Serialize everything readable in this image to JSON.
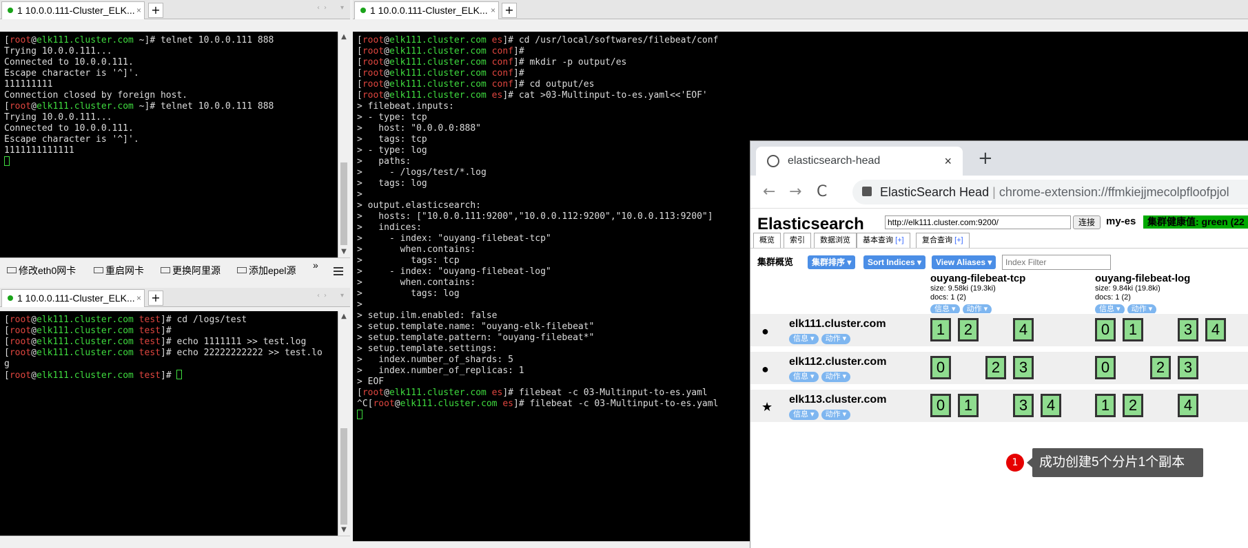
{
  "left_top": {
    "tab_label": "1 10.0.0.111-Cluster_ELK...",
    "close": "×",
    "add": "+",
    "lines": [
      [
        {
          "t": "[",
          "c": ""
        },
        {
          "t": "root",
          "c": "r"
        },
        {
          "t": "@",
          "c": ""
        },
        {
          "t": "elk111.cluster.com",
          "c": "g"
        },
        {
          "t": " ~]# telnet 10.0.0.111 888",
          "c": ""
        }
      ],
      [
        {
          "t": "Trying 10.0.0.111...",
          "c": ""
        }
      ],
      [
        {
          "t": "Connected to 10.0.0.111.",
          "c": ""
        }
      ],
      [
        {
          "t": "Escape character is '^]'.",
          "c": ""
        }
      ],
      [
        {
          "t": "111111111",
          "c": ""
        }
      ],
      [
        {
          "t": "Connection closed by foreign host.",
          "c": ""
        }
      ],
      [
        {
          "t": "[",
          "c": ""
        },
        {
          "t": "root",
          "c": "r"
        },
        {
          "t": "@",
          "c": ""
        },
        {
          "t": "elk111.cluster.com",
          "c": "g"
        },
        {
          "t": " ~]# telnet 10.0.0.111 888",
          "c": ""
        }
      ],
      [
        {
          "t": "Trying 10.0.0.111...",
          "c": ""
        }
      ],
      [
        {
          "t": "Connected to 10.0.0.111.",
          "c": ""
        }
      ],
      [
        {
          "t": "Escape character is '^]'.",
          "c": ""
        }
      ],
      [
        {
          "t": "1111111111111",
          "c": ""
        }
      ]
    ]
  },
  "left_toolbar": {
    "items": [
      "修改eth0网卡",
      "重启网卡",
      "更换阿里源",
      "添加epel源"
    ],
    "more": "»"
  },
  "left_bottom": {
    "tab_label": "1 10.0.0.111-Cluster_ELK...",
    "close": "×",
    "add": "+",
    "lines": [
      [
        {
          "t": "[",
          "c": ""
        },
        {
          "t": "root",
          "c": "r"
        },
        {
          "t": "@",
          "c": ""
        },
        {
          "t": "elk111.cluster.com",
          "c": "g"
        },
        {
          "t": " test",
          "c": "r"
        },
        {
          "t": "]# cd /logs/test",
          "c": ""
        }
      ],
      [
        {
          "t": "[",
          "c": ""
        },
        {
          "t": "root",
          "c": "r"
        },
        {
          "t": "@",
          "c": ""
        },
        {
          "t": "elk111.cluster.com",
          "c": "g"
        },
        {
          "t": " test",
          "c": "r"
        },
        {
          "t": "]#",
          "c": ""
        }
      ],
      [
        {
          "t": "[",
          "c": ""
        },
        {
          "t": "root",
          "c": "r"
        },
        {
          "t": "@",
          "c": ""
        },
        {
          "t": "elk111.cluster.com",
          "c": "g"
        },
        {
          "t": " test",
          "c": "r"
        },
        {
          "t": "]# echo 1111111 >> test.log",
          "c": ""
        }
      ],
      [
        {
          "t": "[",
          "c": ""
        },
        {
          "t": "root",
          "c": "r"
        },
        {
          "t": "@",
          "c": ""
        },
        {
          "t": "elk111.cluster.com",
          "c": "g"
        },
        {
          "t": " test",
          "c": "r"
        },
        {
          "t": "]# echo 22222222222 >> test.lo",
          "c": ""
        }
      ],
      [
        {
          "t": "g",
          "c": ""
        }
      ],
      [
        {
          "t": "[",
          "c": ""
        },
        {
          "t": "root",
          "c": "r"
        },
        {
          "t": "@",
          "c": ""
        },
        {
          "t": "elk111.cluster.com",
          "c": "g"
        },
        {
          "t": " test",
          "c": "r"
        },
        {
          "t": "]# ",
          "c": ""
        }
      ]
    ]
  },
  "right_term": {
    "tab_label": "1 10.0.0.111-Cluster_ELK...",
    "close": "×",
    "add": "+",
    "lines": [
      [
        {
          "t": "[",
          "c": ""
        },
        {
          "t": "root",
          "c": "r"
        },
        {
          "t": "@",
          "c": ""
        },
        {
          "t": "elk111.cluster.com",
          "c": "g"
        },
        {
          "t": " es",
          "c": "r"
        },
        {
          "t": "]# cd /usr/local/softwares/filebeat/conf",
          "c": ""
        }
      ],
      [
        {
          "t": "[",
          "c": ""
        },
        {
          "t": "root",
          "c": "r"
        },
        {
          "t": "@",
          "c": ""
        },
        {
          "t": "elk111.cluster.com",
          "c": "g"
        },
        {
          "t": " conf",
          "c": "r"
        },
        {
          "t": "]#",
          "c": ""
        }
      ],
      [
        {
          "t": "[",
          "c": ""
        },
        {
          "t": "root",
          "c": "r"
        },
        {
          "t": "@",
          "c": ""
        },
        {
          "t": "elk111.cluster.com",
          "c": "g"
        },
        {
          "t": " conf",
          "c": "r"
        },
        {
          "t": "]# mkdir -p output/es",
          "c": ""
        }
      ],
      [
        {
          "t": "[",
          "c": ""
        },
        {
          "t": "root",
          "c": "r"
        },
        {
          "t": "@",
          "c": ""
        },
        {
          "t": "elk111.cluster.com",
          "c": "g"
        },
        {
          "t": " conf",
          "c": "r"
        },
        {
          "t": "]#",
          "c": ""
        }
      ],
      [
        {
          "t": "[",
          "c": ""
        },
        {
          "t": "root",
          "c": "r"
        },
        {
          "t": "@",
          "c": ""
        },
        {
          "t": "elk111.cluster.com",
          "c": "g"
        },
        {
          "t": " conf",
          "c": "r"
        },
        {
          "t": "]# cd output/es",
          "c": ""
        }
      ],
      [
        {
          "t": "[",
          "c": ""
        },
        {
          "t": "root",
          "c": "r"
        },
        {
          "t": "@",
          "c": ""
        },
        {
          "t": "elk111.cluster.com",
          "c": "g"
        },
        {
          "t": " es",
          "c": "r"
        },
        {
          "t": "]# cat >03-Multinput-to-es.yaml<<'EOF'",
          "c": ""
        }
      ],
      [
        {
          "t": "> filebeat.inputs:",
          "c": ""
        }
      ],
      [
        {
          "t": "> - type: tcp",
          "c": ""
        }
      ],
      [
        {
          "t": ">   host: \"0.0.0.0:888\"",
          "c": ""
        }
      ],
      [
        {
          "t": ">   tags: tcp",
          "c": ""
        }
      ],
      [
        {
          "t": "> - type: log",
          "c": ""
        }
      ],
      [
        {
          "t": ">   paths:",
          "c": ""
        }
      ],
      [
        {
          "t": ">     - /logs/test/*.log",
          "c": ""
        }
      ],
      [
        {
          "t": ">   tags: log",
          "c": ""
        }
      ],
      [
        {
          "t": ">",
          "c": ""
        }
      ],
      [
        {
          "t": "> output.elasticsearch:",
          "c": ""
        }
      ],
      [
        {
          "t": ">   hosts: [\"10.0.0.111:9200\",\"10.0.0.112:9200\",\"10.0.0.113:9200\"]",
          "c": ""
        }
      ],
      [
        {
          "t": ">   indices:",
          "c": ""
        }
      ],
      [
        {
          "t": ">     - index: \"ouyang-filebeat-tcp\"",
          "c": ""
        }
      ],
      [
        {
          "t": ">       when.contains:",
          "c": ""
        }
      ],
      [
        {
          "t": ">         tags: tcp",
          "c": ""
        }
      ],
      [
        {
          "t": ">     - index: \"ouyang-filebeat-log\"",
          "c": ""
        }
      ],
      [
        {
          "t": ">       when.contains:",
          "c": ""
        }
      ],
      [
        {
          "t": ">         tags: log",
          "c": ""
        }
      ],
      [
        {
          "t": ">",
          "c": ""
        }
      ],
      [
        {
          "t": "> setup.ilm.enabled: false",
          "c": ""
        }
      ],
      [
        {
          "t": "> setup.template.name: \"ouyang-elk-filebeat\"",
          "c": ""
        }
      ],
      [
        {
          "t": "> setup.template.pattern: \"ouyang-filebeat*\"",
          "c": ""
        }
      ],
      [
        {
          "t": "> setup.template.settings:",
          "c": ""
        }
      ],
      [
        {
          "t": ">   index.number_of_shards: 5",
          "c": ""
        }
      ],
      [
        {
          "t": ">   index.number_of_replicas: 1",
          "c": ""
        }
      ],
      [
        {
          "t": "> EOF",
          "c": ""
        }
      ],
      [
        {
          "t": "[",
          "c": ""
        },
        {
          "t": "root",
          "c": "r"
        },
        {
          "t": "@",
          "c": ""
        },
        {
          "t": "elk111.cluster.com",
          "c": "g"
        },
        {
          "t": " es",
          "c": "r"
        },
        {
          "t": "]# filebeat -c 03-Multinput-to-es.yaml",
          "c": ""
        }
      ],
      [
        {
          "t": "^C[",
          "c": ""
        },
        {
          "t": "root",
          "c": "r"
        },
        {
          "t": "@",
          "c": ""
        },
        {
          "t": "elk111.cluster.com",
          "c": "g"
        },
        {
          "t": " es",
          "c": "r"
        },
        {
          "t": "]# filebeat -c 03-Multinput-to-es.yaml",
          "c": ""
        }
      ]
    ]
  },
  "browser": {
    "tab_title": "elasticsearch-head",
    "tab_close": "×",
    "new_tab": "+",
    "back": "←",
    "forward": "→",
    "reload": "C",
    "url_title": "ElasticSearch Head",
    "url_sep": "|",
    "url_path": "chrome-extension://ffmkiejjmecolpfloofpjol"
  },
  "es": {
    "title": "Elasticsearch",
    "connect_url": "http://elk111.cluster.com:9200/",
    "connect_label": "连接",
    "cluster_name": "my-es",
    "health": "集群健康值: green (22",
    "tabs": [
      "概览",
      "索引",
      "数据浏览",
      "基本查询",
      "复合查询"
    ],
    "tab_plus": "[+]",
    "overview_label": "集群概览",
    "sort_label": "集群排序 ▾",
    "sort_indices": "Sort Indices ▾",
    "view_aliases": "View Aliases ▾",
    "filter_placeholder": "Index Filter",
    "info_label": "信息 ▾",
    "action_label": "动作 ▾",
    "indices": [
      {
        "name": "ouyang-filebeat-tcp",
        "size": "size: 9.58ki (19.3ki)",
        "docs": "docs: 1 (2)"
      },
      {
        "name": "ouyang-filebeat-log",
        "size": "size: 9.84ki (19.8ki)",
        "docs": "docs: 1 (2)"
      }
    ],
    "nodes": [
      {
        "name": "elk111.cluster.com",
        "icon": "●",
        "tcp_shards": [
          "1",
          "2",
          "",
          "4"
        ],
        "log_shards": [
          "0",
          "1",
          "",
          "3",
          "4"
        ]
      },
      {
        "name": "elk112.cluster.com",
        "icon": "●",
        "tcp_shards": [
          "0",
          "",
          "2",
          "3"
        ],
        "log_shards": [
          "0",
          "",
          "2",
          "3"
        ]
      },
      {
        "name": "elk113.cluster.com",
        "icon": "★",
        "tcp_shards": [
          "0",
          "1",
          "",
          "3",
          "4"
        ],
        "log_shards": [
          "1",
          "2",
          "",
          "4"
        ]
      }
    ]
  },
  "callout": {
    "badge": "1",
    "text": "成功创建5个分片1个副本"
  }
}
